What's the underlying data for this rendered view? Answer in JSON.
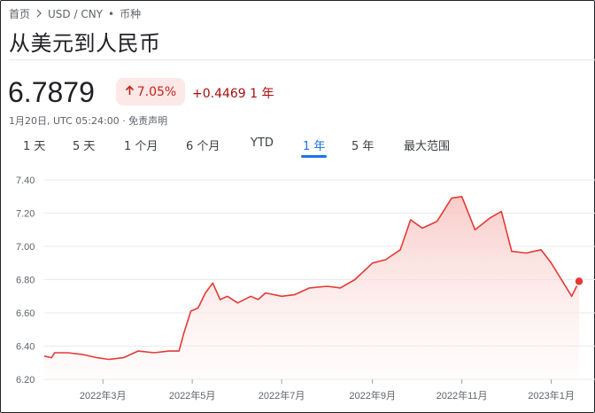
{
  "breadcrumb": {
    "home": "首页",
    "pair": "USD / CNY",
    "dot": "•",
    "category": "币种"
  },
  "title": "从美元到人民币",
  "price": "6.7879",
  "change": {
    "percent": "7.05%",
    "absolute": "+0.4469 1 年"
  },
  "timestamp": "1月20日, UTC 05:24:00 · 免责声明",
  "tabs": [
    "1 天",
    "5 天",
    "1 个月",
    "6 个月",
    "YTD",
    "1 年",
    "5 年",
    "最大范围"
  ],
  "active_tab": "1 年",
  "colors": {
    "line": "#e53935",
    "fill_top": "#f8c9c5",
    "active_tab": "#1a73e8",
    "badge_bg": "#fce8e6",
    "badge_text": "#c5221f"
  },
  "icons": {
    "breadcrumb_sep": "chevron-right-icon",
    "change": "arrow-up-icon"
  },
  "chart_data": {
    "type": "area",
    "ylim": [
      6.2,
      7.4
    ],
    "yticks": [
      "7.40",
      "7.20",
      "7.00",
      "6.80",
      "6.60",
      "6.40",
      "6.20"
    ],
    "xticks": [
      "2022年3月",
      "2022年5月",
      "2022年7月",
      "2022年9月",
      "2022年11月",
      "2023年1月"
    ],
    "grid": true,
    "series": [
      {
        "points": [
          [
            "2022-01-20",
            6.34
          ],
          [
            "2022-01-25",
            6.33
          ],
          [
            "2022-01-27",
            6.36
          ],
          [
            "2022-02-05",
            6.36
          ],
          [
            "2022-02-15",
            6.35
          ],
          [
            "2022-02-25",
            6.33
          ],
          [
            "2022-03-05",
            6.32
          ],
          [
            "2022-03-15",
            6.33
          ],
          [
            "2022-03-25",
            6.37
          ],
          [
            "2022-04-05",
            6.36
          ],
          [
            "2022-04-15",
            6.37
          ],
          [
            "2022-04-22",
            6.37
          ],
          [
            "2022-04-25",
            6.47
          ],
          [
            "2022-04-30",
            6.61
          ],
          [
            "2022-05-05",
            6.63
          ],
          [
            "2022-05-10",
            6.72
          ],
          [
            "2022-05-15",
            6.78
          ],
          [
            "2022-05-20",
            6.68
          ],
          [
            "2022-05-25",
            6.7
          ],
          [
            "2022-06-01",
            6.66
          ],
          [
            "2022-06-10",
            6.7
          ],
          [
            "2022-06-15",
            6.68
          ],
          [
            "2022-06-20",
            6.72
          ],
          [
            "2022-07-01",
            6.7
          ],
          [
            "2022-07-10",
            6.71
          ],
          [
            "2022-07-20",
            6.75
          ],
          [
            "2022-08-01",
            6.76
          ],
          [
            "2022-08-10",
            6.75
          ],
          [
            "2022-08-20",
            6.8
          ],
          [
            "2022-09-01",
            6.9
          ],
          [
            "2022-09-10",
            6.92
          ],
          [
            "2022-09-20",
            6.98
          ],
          [
            "2022-09-27",
            7.16
          ],
          [
            "2022-10-05",
            7.11
          ],
          [
            "2022-10-15",
            7.15
          ],
          [
            "2022-10-25",
            7.29
          ],
          [
            "2022-11-01",
            7.3
          ],
          [
            "2022-11-10",
            7.1
          ],
          [
            "2022-11-20",
            7.17
          ],
          [
            "2022-11-28",
            7.21
          ],
          [
            "2022-12-05",
            6.97
          ],
          [
            "2022-12-15",
            6.96
          ],
          [
            "2022-12-25",
            6.98
          ],
          [
            "2023-01-01",
            6.9
          ],
          [
            "2023-01-08",
            6.8
          ],
          [
            "2023-01-15",
            6.7
          ],
          [
            "2023-01-20",
            6.79
          ]
        ]
      }
    ]
  }
}
